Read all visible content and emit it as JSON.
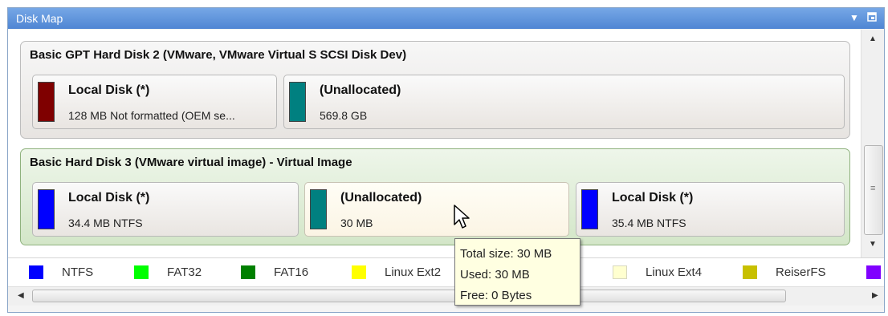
{
  "panel": {
    "title": "Disk Map",
    "menu_icon": "dropdown-arrow-icon",
    "pin_icon": "pin-icon"
  },
  "disks": [
    {
      "title": "Basic GPT Hard Disk 2 (VMware, VMware Virtual S SCSI Disk Dev)",
      "partitions": [
        {
          "label": "Local Disk (*)",
          "detail": "128 MB Not formatted (OEM se...",
          "color": "#7f0000"
        },
        {
          "label": "(Unallocated)",
          "detail": "569.8 GB",
          "color": "#008080"
        }
      ]
    },
    {
      "title": "Basic Hard Disk 3 (VMware virtual image) - Virtual Image",
      "partitions": [
        {
          "label": "Local Disk (*)",
          "detail": "34.4 MB NTFS",
          "color": "#0000ff"
        },
        {
          "label": "(Unallocated)",
          "detail": "30 MB",
          "color": "#008080"
        },
        {
          "label": "Local Disk (*)",
          "detail": "35.4 MB NTFS",
          "color": "#0000ff"
        }
      ]
    }
  ],
  "legend": [
    {
      "label": "NTFS",
      "color": "#0000ff"
    },
    {
      "label": "FAT32",
      "color": "#00ff00"
    },
    {
      "label": "FAT16",
      "color": "#008000"
    },
    {
      "label": "Linux Ext2",
      "color": "#ffff00"
    },
    {
      "label": "Linux Ext4",
      "color": "#ffffd0"
    },
    {
      "label": "ReiserFS",
      "color": "#c8c000"
    },
    {
      "label": "",
      "color": "#8000ff"
    }
  ],
  "tooltip": {
    "lines": [
      "Total size: 30 MB",
      "Used: 30 MB",
      "Free: 0 Bytes"
    ]
  },
  "icons": {
    "cursor": "mouse-pointer-icon",
    "scroll_up": "scroll-up-arrow-icon",
    "scroll_down": "scroll-down-arrow-icon",
    "scroll_left": "scroll-left-arrow-icon",
    "scroll_right": "scroll-right-arrow-icon"
  }
}
